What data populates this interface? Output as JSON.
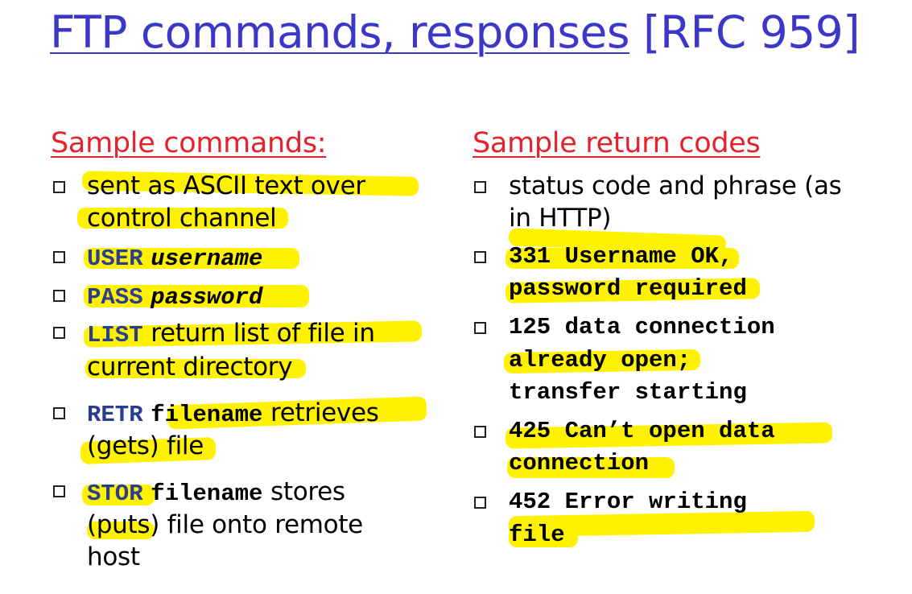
{
  "title": {
    "underlined": "FTP commands, responses",
    "rest": " [RFC 959]"
  },
  "left": {
    "heading": "Sample commands:",
    "items": [
      {
        "lines": [
          "sent as ASCII text over",
          "control channel"
        ]
      },
      {
        "cmd": "USER",
        "arg": "username"
      },
      {
        "cmd": "PASS",
        "arg": "password"
      },
      {
        "cmd": "LIST",
        "text": "return list of file in",
        "line2": "current directory"
      },
      {
        "cmd": "RETR",
        "arg": "filename",
        "text": "retrieves",
        "line2": "(gets) file"
      },
      {
        "cmd": "STOR",
        "arg": "filename",
        "text": "stores",
        "line2": "(puts) file onto remote",
        "line3": "host"
      }
    ]
  },
  "right": {
    "heading": "Sample return codes",
    "items": [
      {
        "lines": [
          "status code and phrase (as",
          "in HTTP)"
        ]
      },
      {
        "lines": [
          "331 Username OK,",
          "password required"
        ]
      },
      {
        "lines": [
          "125 data connection",
          "already open;",
          "transfer starting"
        ]
      },
      {
        "lines": [
          "425 Can’t open data",
          "connection"
        ]
      },
      {
        "lines": [
          "452 Error writing",
          "file"
        ]
      }
    ]
  },
  "colors": {
    "title": "#3b37c9",
    "heading": "#e5212b",
    "highlight": "#fff200",
    "command": "#2a3d8f"
  }
}
